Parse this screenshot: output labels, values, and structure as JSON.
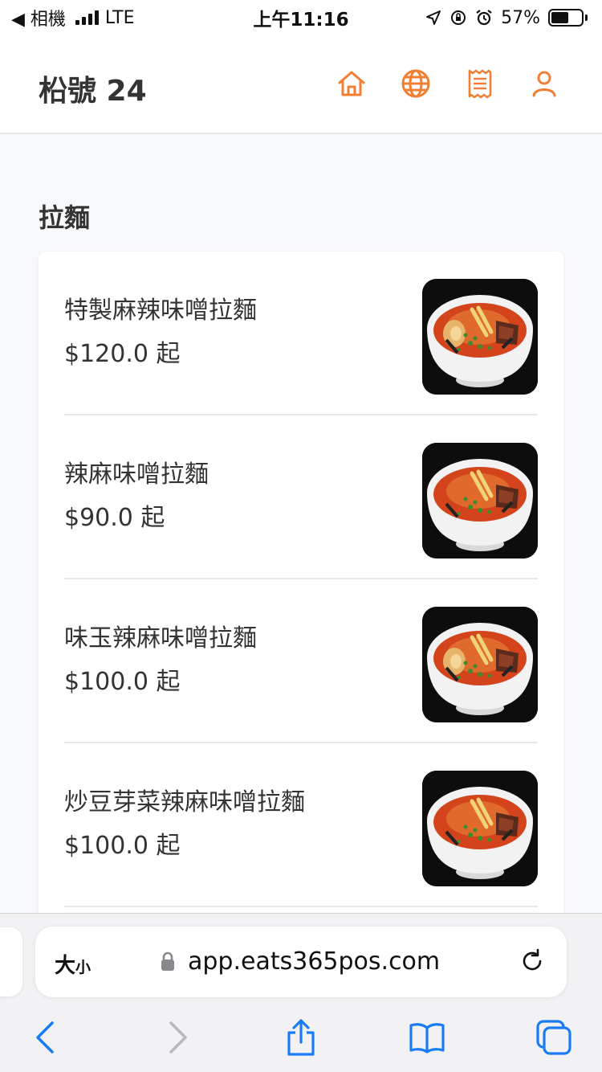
{
  "status_bar": {
    "back_label": "◀ 相機",
    "network": "LTE",
    "time": "上午11:16",
    "battery_text": "57%",
    "battery_level": 0.57
  },
  "header": {
    "store_name": "柗號 24",
    "accent_color": "#f07f34",
    "icons": [
      "home-icon",
      "globe-icon",
      "receipt-icon",
      "user-icon"
    ]
  },
  "section": {
    "title": "拉麵"
  },
  "menu_items": [
    {
      "name": "特製麻辣味噌拉麵",
      "price": "$120.0 起",
      "has_egg": true
    },
    {
      "name": "辣麻味噌拉麵",
      "price": "$90.0 起",
      "has_egg": false
    },
    {
      "name": "味玉辣麻味噌拉麵",
      "price": "$100.0 起",
      "has_egg": true
    },
    {
      "name": "炒豆芽菜辣麻味噌拉麵",
      "price": "$100.0 起",
      "has_egg": false
    }
  ],
  "browser": {
    "text_size_label_big": "大",
    "text_size_label_small": "小",
    "url": "app.eats365pos.com",
    "tint_color": "#1a7cf5"
  }
}
